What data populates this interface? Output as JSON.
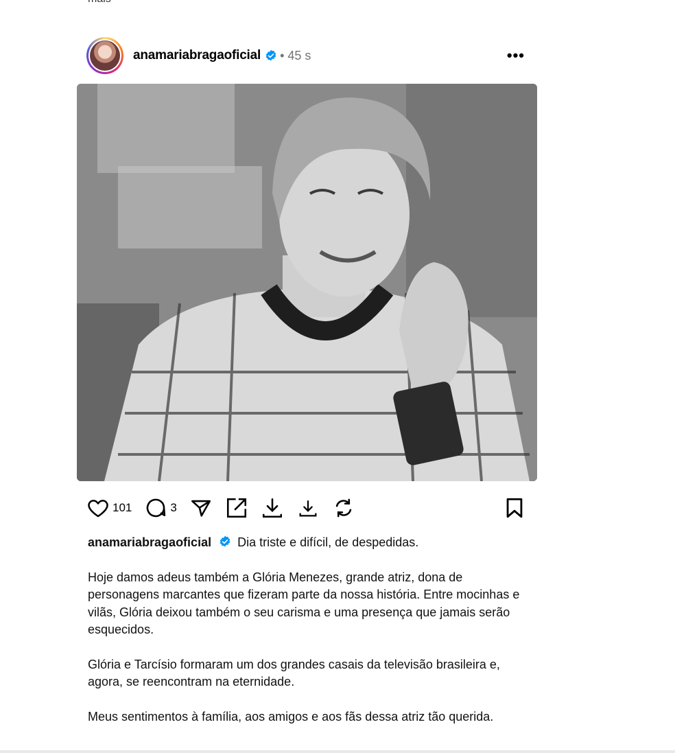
{
  "post": {
    "username": "anamariabragaoficial",
    "time": "• 45 s",
    "more_label": "•••",
    "likes": "101",
    "comments": "3",
    "caption_first": "Dia triste e difícil, de despedidas.",
    "paragraphs": [
      "Hoje damos adeus também a Glória Menezes, grande atriz, dona de personagens marcantes que fizeram parte da nossa história. Entre mocinhas e vilãs, Glória deixou também o seu carisma e uma presença que jamais serão esquecidos.",
      "Glória e Tarcísio formaram um dos grandes casais da televisão brasileira e, agora, se reencontram na eternidade.",
      "Meus sentimentos à família, aos amigos e aos fãs dessa atriz tão querida."
    ]
  },
  "icons": {
    "verified": "verified-badge-icon",
    "like": "heart-icon",
    "comment": "comment-icon",
    "share": "paper-plane-icon",
    "open": "external-link-icon",
    "download1": "download-icon",
    "download2": "download-icon",
    "refresh": "refresh-icon",
    "save": "bookmark-icon"
  },
  "colors": {
    "verified": "#0095f6",
    "muted": "#737373"
  }
}
